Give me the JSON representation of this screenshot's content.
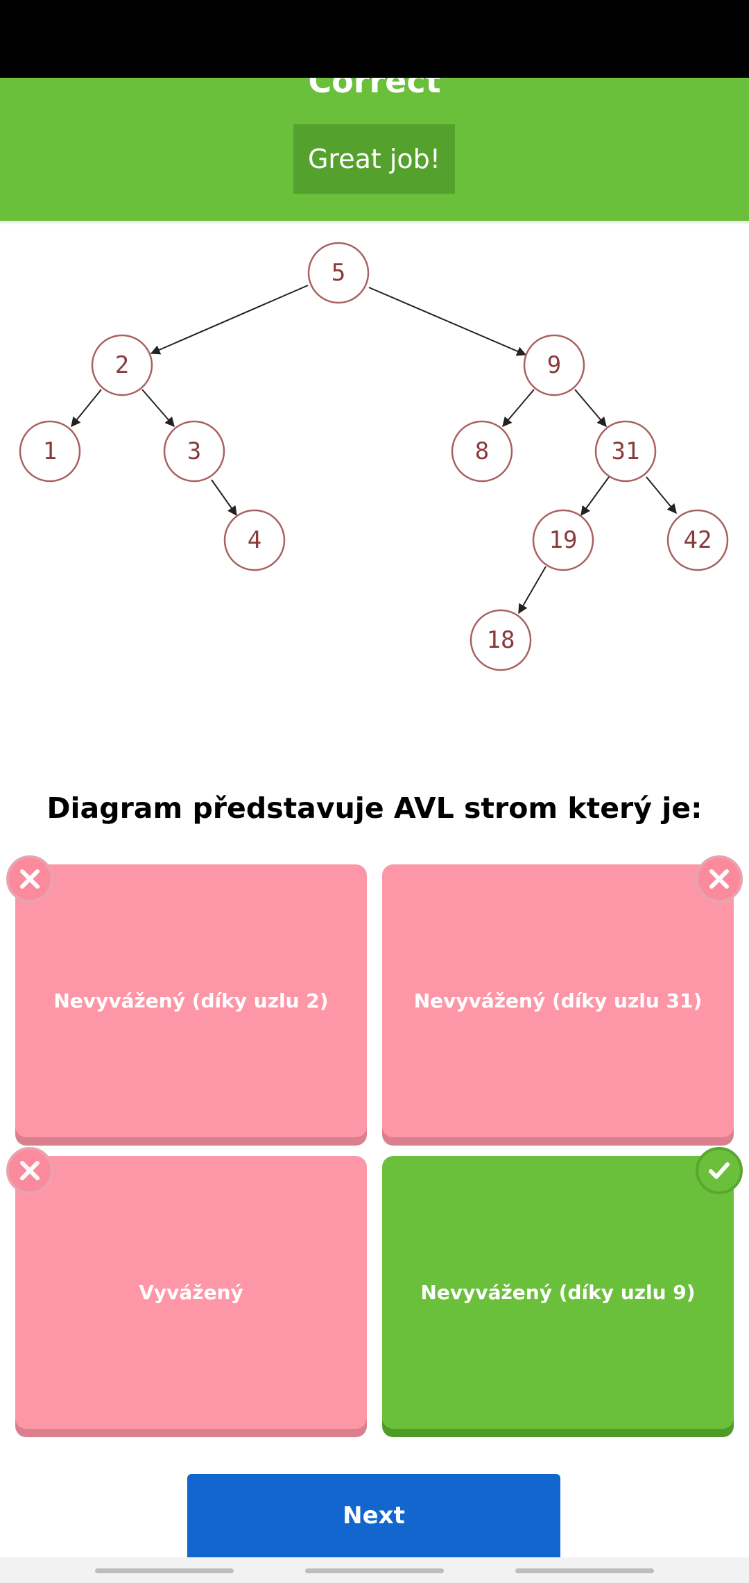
{
  "feedback": {
    "title": "Correct",
    "message": "Great job!"
  },
  "tree": {
    "nodes": [
      "5",
      "2",
      "9",
      "1",
      "3",
      "8",
      "31",
      "4",
      "19",
      "42",
      "18"
    ]
  },
  "question": "Diagram představuje AVL strom který je:",
  "options": [
    {
      "label": "Nevyvážený (díky uzlu 2)",
      "status": "wrong",
      "badge_icon": "x-icon"
    },
    {
      "label": "Nevyvážený (díky uzlu 31)",
      "status": "wrong",
      "badge_icon": "x-icon"
    },
    {
      "label": "Vyvážený",
      "status": "wrong",
      "badge_icon": "x-icon"
    },
    {
      "label": "Nevyvážený (díky uzlu 9)",
      "status": "correct",
      "badge_icon": "check-icon"
    }
  ],
  "next_button": "Next",
  "colors": {
    "correct_green": "#6abf3b",
    "wrong_pink": "#fd97a8",
    "primary_blue": "#1366ce"
  }
}
